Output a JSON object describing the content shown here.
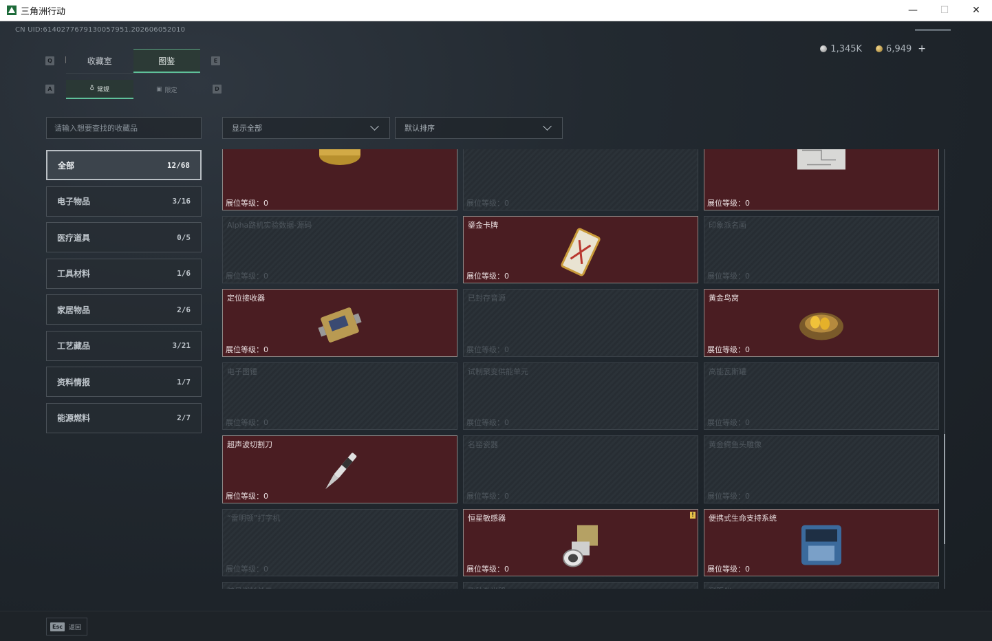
{
  "window": {
    "title": "三角洲行动",
    "minimize": "—",
    "maximize": "☐",
    "close": "✕"
  },
  "uid": "CN UID:6140277679130057951.202606052010",
  "currency": [
    {
      "icon": "silver-coin-icon",
      "value": "1,345K"
    },
    {
      "icon": "gold-coin-icon",
      "value": "6,949"
    }
  ],
  "currency_add": "+",
  "keys": {
    "tab_left": "Q",
    "tab_right": "E",
    "sub_left": "A",
    "sub_right": "D"
  },
  "tabs": [
    {
      "label": "收藏室",
      "active": false
    },
    {
      "label": "图鉴",
      "active": true
    }
  ],
  "subtabs": [
    {
      "label": "常规",
      "active": true
    },
    {
      "label": "限定",
      "active": false
    }
  ],
  "search": {
    "placeholder": "请输入想要查找的收藏品"
  },
  "filter": {
    "selected": "显示全部"
  },
  "sort": {
    "selected": "默认排序"
  },
  "categories": [
    {
      "label": "全部",
      "count": "12/68",
      "active": true
    },
    {
      "label": "电子物品",
      "count": "3/16"
    },
    {
      "label": "医疗道具",
      "count": "0/5"
    },
    {
      "label": "工具材料",
      "count": "1/6"
    },
    {
      "label": "家居物品",
      "count": "2/6"
    },
    {
      "label": "工艺藏品",
      "count": "3/21"
    },
    {
      "label": "资料情报",
      "count": "1/7"
    },
    {
      "label": "能源燃料",
      "count": "2/7"
    }
  ],
  "level_label": "展位等级：",
  "items": [
    {
      "name": "",
      "owned": true,
      "level": "0",
      "icon": "gold-box-icon"
    },
    {
      "name": "",
      "owned": false,
      "level": "0",
      "icon": "bottle-icon"
    },
    {
      "name": "",
      "owned": true,
      "level": "0",
      "icon": "blueprint-map-icon"
    },
    {
      "name": "Alpha路机实验数据-源码",
      "owned": false,
      "level": "0",
      "icon": "drive-icon"
    },
    {
      "name": "鎏金卡牌",
      "owned": true,
      "level": "0",
      "icon": "gilded-card-icon"
    },
    {
      "name": "印象派名画",
      "owned": false,
      "level": "0",
      "icon": "picture-frame-icon"
    },
    {
      "name": "定位接收器",
      "owned": true,
      "level": "0",
      "icon": "receiver-icon"
    },
    {
      "name": "已封存音源",
      "owned": false,
      "level": "0",
      "icon": "audio-icon"
    },
    {
      "name": "黄金鸟窝",
      "owned": true,
      "level": "0",
      "icon": "golden-nest-icon"
    },
    {
      "name": "电子图锤",
      "owned": false,
      "level": "0",
      "icon": "device-icon"
    },
    {
      "name": "试制聚变供能单元",
      "owned": false,
      "level": "0",
      "icon": "fusion-unit-icon"
    },
    {
      "name": "高能瓦斯罐",
      "owned": false,
      "level": "0",
      "icon": "gas-tank-icon"
    },
    {
      "name": "超声波切割刀",
      "owned": true,
      "level": "0",
      "icon": "ultrasonic-cutter-icon"
    },
    {
      "name": "名窑瓷器",
      "owned": false,
      "level": "0",
      "icon": "vase-icon"
    },
    {
      "name": "黄金鳄鱼头雕像",
      "owned": false,
      "level": "0",
      "icon": "statue-icon"
    },
    {
      "name": "“雷明顿”打字机",
      "owned": false,
      "level": "0",
      "icon": "typewriter-icon"
    },
    {
      "name": "恒星敏感器",
      "owned": true,
      "level": "0",
      "icon": "star-sensor-icon",
      "badge": "!"
    },
    {
      "name": "便携式生命支持系统",
      "owned": true,
      "level": "0",
      "icon": "life-support-icon"
    },
    {
      "name": "暗星燃料单元",
      "owned": false,
      "level": "",
      "icon": "fuel-cell-icon"
    },
    {
      "name": "飞秒激光器",
      "owned": false,
      "level": "",
      "icon": "laser-icon"
    },
    {
      "name": "测距仪",
      "owned": false,
      "level": "",
      "icon": "rangefinder-icon"
    }
  ],
  "bottom": {
    "key": "Esc",
    "label": "返回"
  }
}
